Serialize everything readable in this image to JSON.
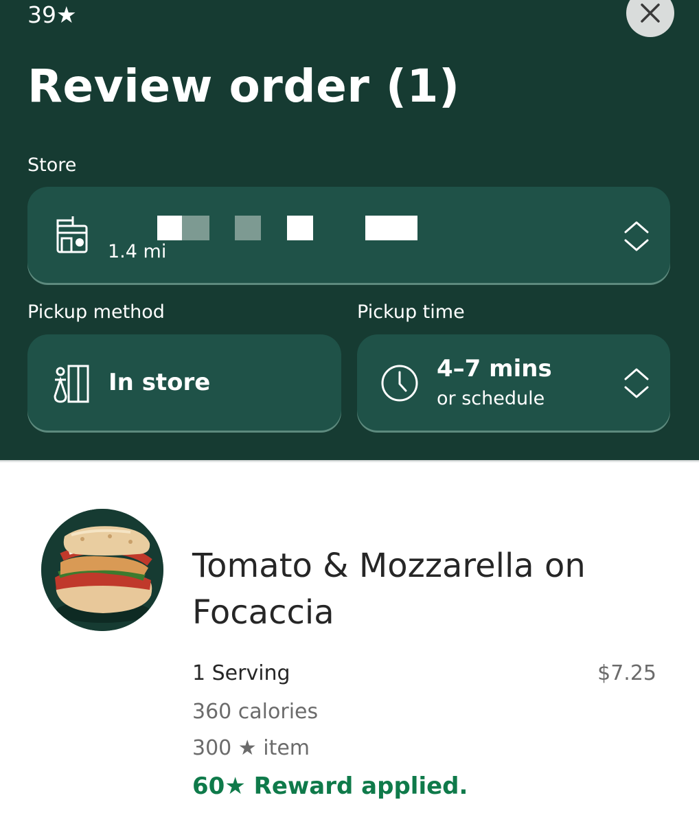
{
  "status": {
    "stars": "39★"
  },
  "header": {
    "title": "Review order (1)",
    "close_icon": "close-icon"
  },
  "store": {
    "label": "Store",
    "distance": "1.4 mi",
    "icon": "store-icon",
    "chevron_icon": "chevron-updown-icon"
  },
  "pickup_method": {
    "label": "Pickup method",
    "value": "In store",
    "icon": "in-store-icon"
  },
  "pickup_time": {
    "label": "Pickup time",
    "value": "4–7 mins",
    "sub": "or schedule",
    "icon": "clock-icon",
    "chevron_icon": "chevron-updown-icon"
  },
  "order_item": {
    "name": "Tomato & Mozzarella on Focaccia",
    "serving": "1 Serving",
    "price": "$7.25",
    "calories": "360 calories",
    "star_cost": "300 ★ item",
    "reward": "60★ Reward applied."
  },
  "colors": {
    "header_bg": "#163b32",
    "card_bg": "#1f5248",
    "reward_green": "#0f7a4a"
  }
}
